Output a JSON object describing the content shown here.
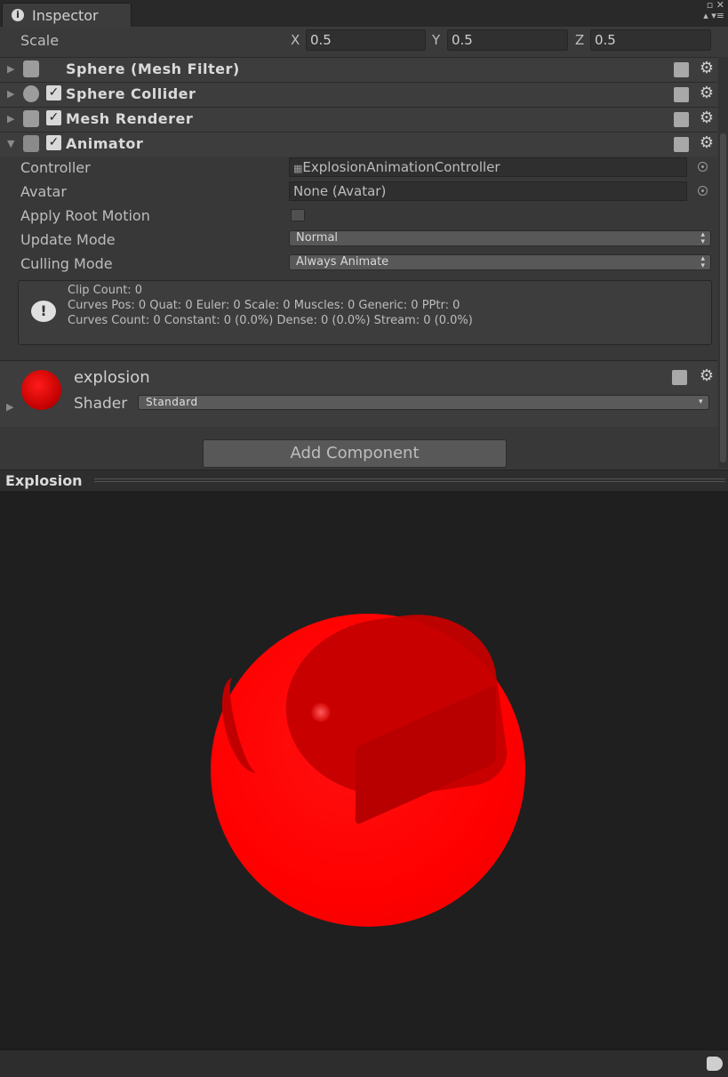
{
  "tab": {
    "title": "Inspector",
    "window_buttons": "▫ ✕\n▴ ▾≡"
  },
  "transform": {
    "scale_label": "Scale",
    "x_label": "X",
    "x_value": "0.5",
    "y_label": "Y",
    "y_value": "0.5",
    "z_label": "Z",
    "z_value": "0.5"
  },
  "components": {
    "mesh_filter": "Sphere (Mesh Filter)",
    "sphere_collider": "Sphere Collider",
    "mesh_renderer": "Mesh Renderer",
    "animator": "Animator"
  },
  "animator": {
    "controller_label": "Controller",
    "controller_value": "ExplosionAnimationController",
    "avatar_label": "Avatar",
    "avatar_value": "None (Avatar)",
    "apply_root_motion_label": "Apply Root Motion",
    "apply_root_motion_checked": false,
    "update_mode_label": "Update Mode",
    "update_mode_value": "Normal",
    "culling_mode_label": "Culling Mode",
    "culling_mode_value": "Always Animate",
    "info": {
      "line1": "Clip Count: 0",
      "line2": "Curves Pos: 0 Quat: 0 Euler: 0 Scale: 0 Muscles: 0 Generic: 0 PPtr: 0",
      "line3": "Curves Count: 0 Constant: 0 (0.0%) Dense: 0 (0.0%) Stream: 0 (0.0%)"
    }
  },
  "material": {
    "name": "explosion",
    "shader_label": "Shader",
    "shader_value": "Standard",
    "color": "#e00000"
  },
  "add_component_label": "Add Component",
  "preview": {
    "title": "Explosion",
    "sphere_color": "#ff0000"
  },
  "icons": [
    "info-icon",
    "book-icon",
    "gear-icon",
    "checkmark-icon",
    "tag-icon",
    "object-picker-icon"
  ]
}
